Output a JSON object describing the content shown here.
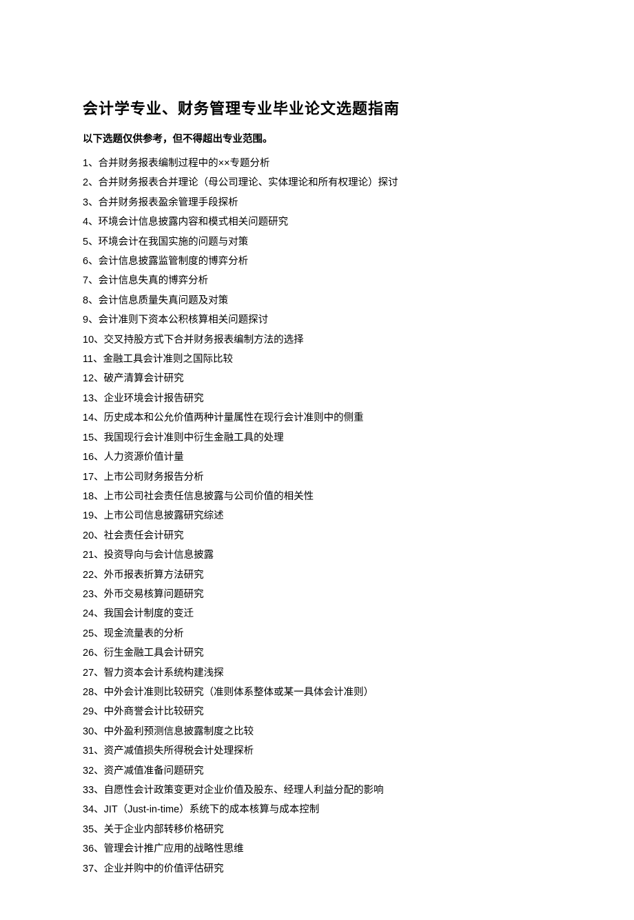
{
  "title": "会计学专业、财务管理专业毕业论文选题指南",
  "subtitle": "以下选题仅供参考，但不得超出专业范围。",
  "separator": "、",
  "items": [
    {
      "n": "1",
      "t": "合并财务报表编制过程中的××专题分析"
    },
    {
      "n": "2",
      "t": "合并财务报表合并理论（母公司理论、实体理论和所有权理论）探讨"
    },
    {
      "n": "3",
      "t": "合并财务报表盈余管理手段探析"
    },
    {
      "n": "4",
      "t": "环境会计信息披露内容和模式相关问题研究"
    },
    {
      "n": "5",
      "t": "环境会计在我国实施的问题与对策"
    },
    {
      "n": "6",
      "t": "会计信息披露监管制度的博弈分析"
    },
    {
      "n": "7",
      "t": "会计信息失真的博弈分析"
    },
    {
      "n": "8",
      "t": "会计信息质量失真问题及对策"
    },
    {
      "n": "9",
      "t": "会计准则下资本公积核算相关问题探讨"
    },
    {
      "n": "10",
      "t": "交叉持股方式下合并财务报表编制方法的选择"
    },
    {
      "n": "11",
      "t": "金融工具会计准则之国际比较"
    },
    {
      "n": "12",
      "t": "破产清算会计研究"
    },
    {
      "n": "13",
      "t": "企业环境会计报告研究"
    },
    {
      "n": "14",
      "t": "历史成本和公允价值两种计量属性在现行会计准则中的侧重"
    },
    {
      "n": "15",
      "t": "我国现行会计准则中衍生金融工具的处理"
    },
    {
      "n": "16",
      "t": "人力资源价值计量"
    },
    {
      "n": "17",
      "t": "上市公司财务报告分析"
    },
    {
      "n": "18",
      "t": "上市公司社会责任信息披露与公司价值的相关性"
    },
    {
      "n": "19",
      "t": "上市公司信息披露研究综述"
    },
    {
      "n": "20",
      "t": "社会责任会计研究"
    },
    {
      "n": "21",
      "t": "投资导向与会计信息披露"
    },
    {
      "n": "22",
      "t": "外币报表折算方法研究"
    },
    {
      "n": "23",
      "t": "外币交易核算问题研究"
    },
    {
      "n": "24",
      "t": "我国会计制度的变迁"
    },
    {
      "n": "25",
      "t": "现金流量表的分析"
    },
    {
      "n": "26",
      "t": "衍生金融工具会计研究"
    },
    {
      "n": "27",
      "t": "智力资本会计系统构建浅探"
    },
    {
      "n": "28",
      "t": "中外会计准则比较研究（准则体系整体或某一具体会计准则）"
    },
    {
      "n": "29",
      "t": "中外商誉会计比较研究"
    },
    {
      "n": "30",
      "t": "中外盈利预测信息披露制度之比较"
    },
    {
      "n": "31",
      "t": "资产减值损失所得税会计处理探析"
    },
    {
      "n": "32",
      "t": "资产减值准备问题研究"
    },
    {
      "n": "33",
      "t": "自愿性会计政策变更对企业价值及股东、经理人利益分配的影响"
    },
    {
      "n": "34",
      "t": "JIT（Just-in-time）系统下的成本核算与成本控制"
    },
    {
      "n": "35",
      "t": "关于企业内部转移价格研究"
    },
    {
      "n": "36",
      "t": "管理会计推广应用的战略性思维"
    },
    {
      "n": "37",
      "t": "企业并购中的价值评估研究"
    }
  ]
}
